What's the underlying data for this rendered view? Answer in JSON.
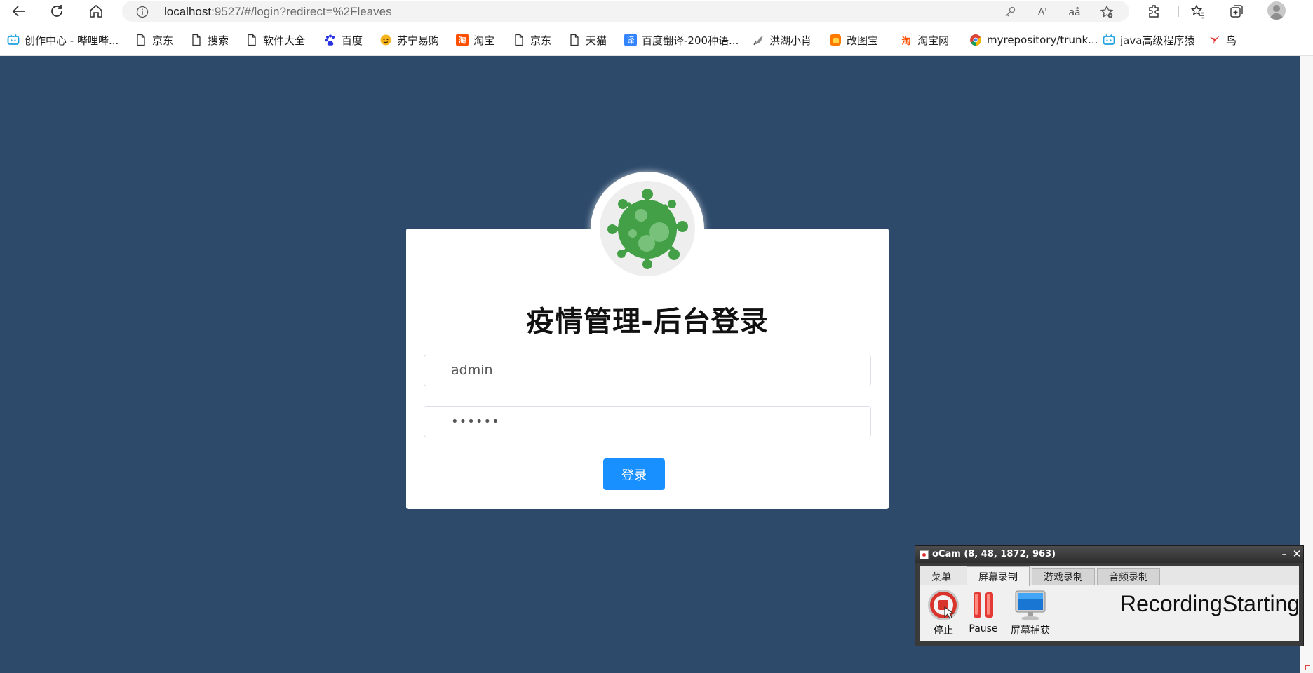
{
  "browser": {
    "url_host": "localhost",
    "url_rest": ":9527/#/login?redirect=%2Fleaves",
    "read_aloud_label": "Aʹ",
    "translate_label": "aå"
  },
  "bookmarks": [
    {
      "label": "创作中心 - 哔哩哔...",
      "icon": "bilibili-icon"
    },
    {
      "label": "京东",
      "icon": "page-icon"
    },
    {
      "label": "搜索",
      "icon": "page-icon"
    },
    {
      "label": "软件大全",
      "icon": "page-icon"
    },
    {
      "label": "百度",
      "icon": "baidu-paw-icon"
    },
    {
      "label": "苏宁易购",
      "icon": "suning-icon"
    },
    {
      "label": "淘宝",
      "icon": "taobao-icon"
    },
    {
      "label": "京东",
      "icon": "page-icon"
    },
    {
      "label": "天猫",
      "icon": "page-icon"
    },
    {
      "label": "百度翻译-200种语...",
      "icon": "translate-icon",
      "icon_text": "译"
    },
    {
      "label": "洪湖小肖",
      "icon": "bird-icon"
    },
    {
      "label": "改图宝",
      "icon": "gaitubao-icon"
    },
    {
      "label": "淘宝网",
      "icon": "taobao-icon",
      "icon_text": "淘"
    },
    {
      "label": "myrepository/trunk...",
      "icon": "chrome-icon"
    },
    {
      "label": "java高级程序猿",
      "icon": "bilibili-icon"
    },
    {
      "label": "鸟",
      "icon": "red-bird-icon"
    }
  ],
  "login": {
    "title": "疫情管理-后台登录",
    "username": "admin",
    "password_mask": "••••••",
    "submit_label": "登录"
  },
  "ocam": {
    "title": "oCam (8, 48, 1872, 963)",
    "tabs": [
      "菜单",
      "屏幕录制",
      "游戏录制",
      "音频录制"
    ],
    "active_tab": "屏幕录制",
    "tools": [
      {
        "label": "停止",
        "icon": "stop-icon"
      },
      {
        "label": "Pause",
        "icon": "pause-icon"
      },
      {
        "label": "屏幕捕获",
        "icon": "monitor-icon"
      }
    ],
    "status": "RecordingStarting"
  },
  "colors": {
    "page_background": "#2d4a6b",
    "primary_button": "#1890ff",
    "virus_green": "#43a047"
  }
}
